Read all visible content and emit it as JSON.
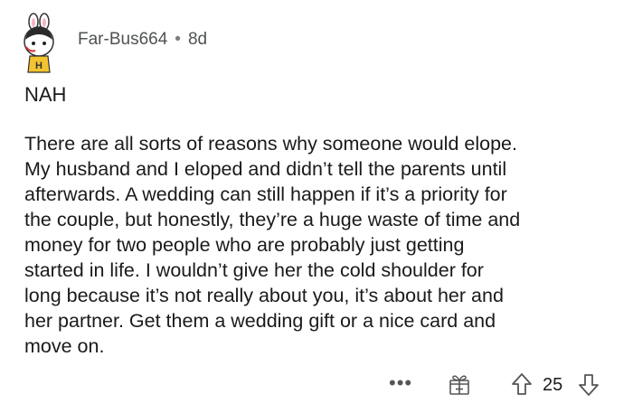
{
  "comment": {
    "author": "Far-Bus664",
    "separator": "•",
    "age": "8d",
    "title_line": "NAH",
    "body_lines": [
      "There are all sorts of reasons why someone would elope.",
      "My husband and I eloped and didn’t tell the parents until",
      "afterwards. A wedding can still happen if it’s a priority for",
      "the couple, but honestly, they’re a huge waste of time and",
      "money for two people who are probably just getting",
      "started in life. I wouldn’t give her the cold shoulder for",
      "long because it’s not really about you, it’s about her and",
      "her partner. Get them a wedding gift or a nice card and",
      "move on."
    ]
  },
  "actions": {
    "more_label": "•••",
    "score": "25",
    "icons": {
      "more": "more-options-icon",
      "gift": "gift-award-icon",
      "upvote": "upvote-arrow-icon",
      "downvote": "downvote-arrow-icon"
    }
  },
  "colors": {
    "text": "#1a1a1b",
    "meta": "#4f5253",
    "icon": "#555555",
    "avatar_accent": "#f4c430"
  }
}
